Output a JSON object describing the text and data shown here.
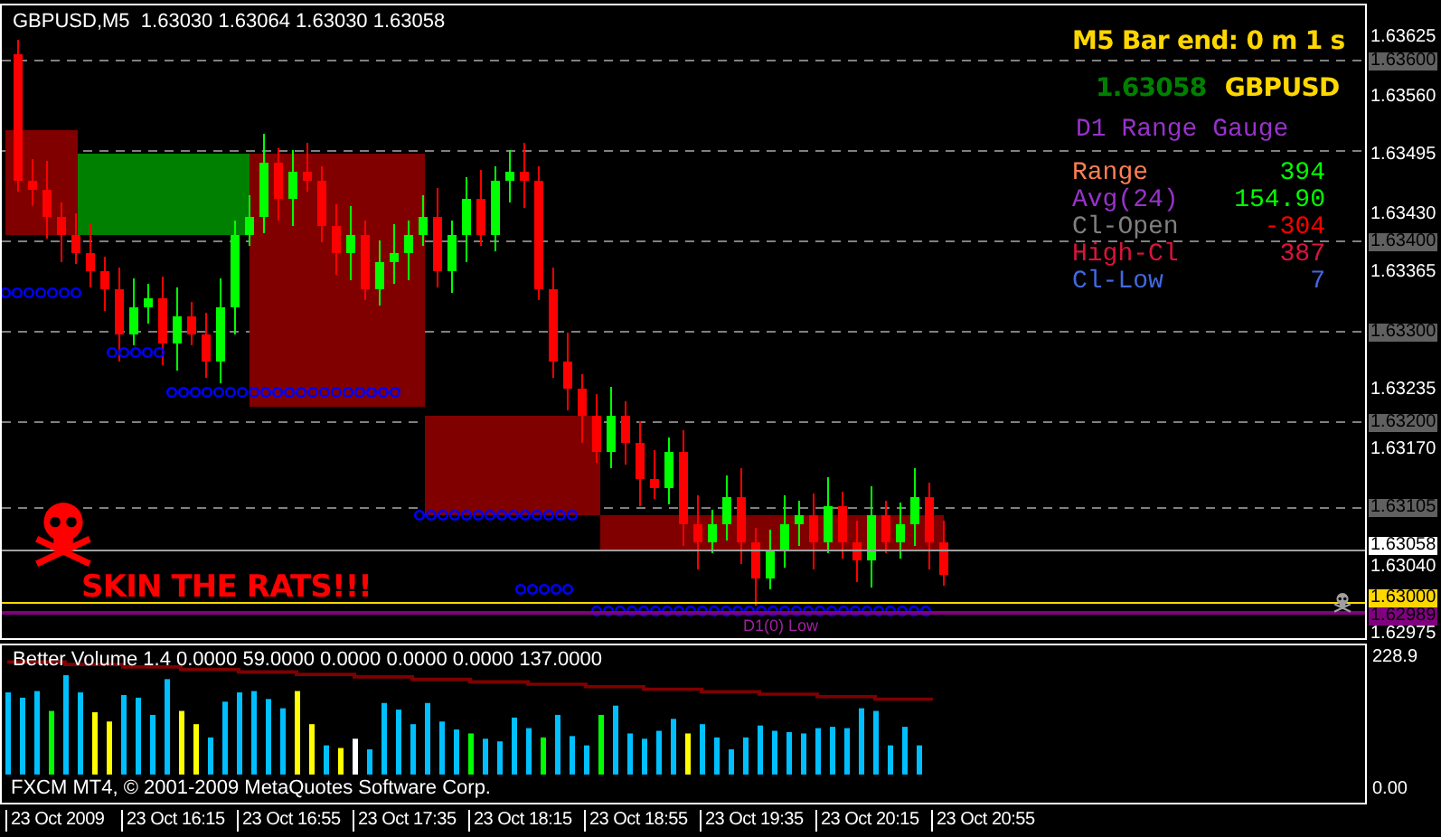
{
  "chart": {
    "symbol": "GBPUSD,M5",
    "ohlc": "1.63030 1.63064 1.63030 1.63058",
    "bar_timer": "M5 Bar end: 0 m 1 s",
    "bid": "1.63058",
    "pair": "GBPUSD",
    "gauge": {
      "title": "D1 Range Gauge",
      "rows": [
        {
          "label": {
            "text": "Range",
            "color": "#ff7f50"
          },
          "value": {
            "text": "394",
            "color": "#00ff00"
          }
        },
        {
          "label": {
            "text": "Avg(24)",
            "color": "#9932cc"
          },
          "value": {
            "text": "154.90",
            "color": "#00ff00"
          }
        },
        {
          "label": {
            "text": "Cl-Open",
            "color": "#808080"
          },
          "value": {
            "text": "-304",
            "color": "#ff0000"
          }
        },
        {
          "label": {
            "text": "High-Cl",
            "color": "#dc143c"
          },
          "value": {
            "text": "387",
            "color": "#dc143c"
          }
        },
        {
          "label": {
            "text": "Cl-Low",
            "color": "#4169e1"
          },
          "value": {
            "text": "7",
            "color": "#4169e1"
          }
        }
      ]
    },
    "slogan": "SKIN THE RATS!!!",
    "level_label": "D1(0) Low"
  },
  "price_axis": [
    {
      "label": "1.63625",
      "kind": "plain"
    },
    {
      "label": "1.63600",
      "kind": "gray"
    },
    {
      "label": "1.63560",
      "kind": "plain"
    },
    {
      "label": "1.63495",
      "kind": "plain"
    },
    {
      "label": "1.63430",
      "kind": "plain"
    },
    {
      "label": "1.63400",
      "kind": "gray"
    },
    {
      "label": "1.63365",
      "kind": "plain"
    },
    {
      "label": "1.63300",
      "kind": "gray"
    },
    {
      "label": "1.63235",
      "kind": "plain"
    },
    {
      "label": "1.63200",
      "kind": "gray"
    },
    {
      "label": "1.63170",
      "kind": "plain"
    },
    {
      "label": "1.63105",
      "kind": "gray"
    },
    {
      "label": "1.63058",
      "kind": "white"
    },
    {
      "label": "1.63040",
      "kind": "plain"
    },
    {
      "label": "1.63000",
      "kind": "yellow"
    },
    {
      "label": "1.62989",
      "kind": "purple"
    },
    {
      "label": "1.62975",
      "kind": "plain"
    }
  ],
  "volume": {
    "title": "Better Volume 1.4 0.0000 59.0000 0.0000 0.0000 0.0000 137.0000",
    "axis": [
      "228.9",
      "0.00"
    ],
    "copyright": "FXCM MT4, © 2001-2009 MetaQuotes Software Corp."
  },
  "time_axis": [
    "23 Oct 2009",
    "23 Oct 16:15",
    "23 Oct 16:55",
    "23 Oct 17:35",
    "23 Oct 18:15",
    "23 Oct 18:55",
    "23 Oct 19:35",
    "23 Oct 20:15",
    "23 Oct 20:55"
  ]
}
